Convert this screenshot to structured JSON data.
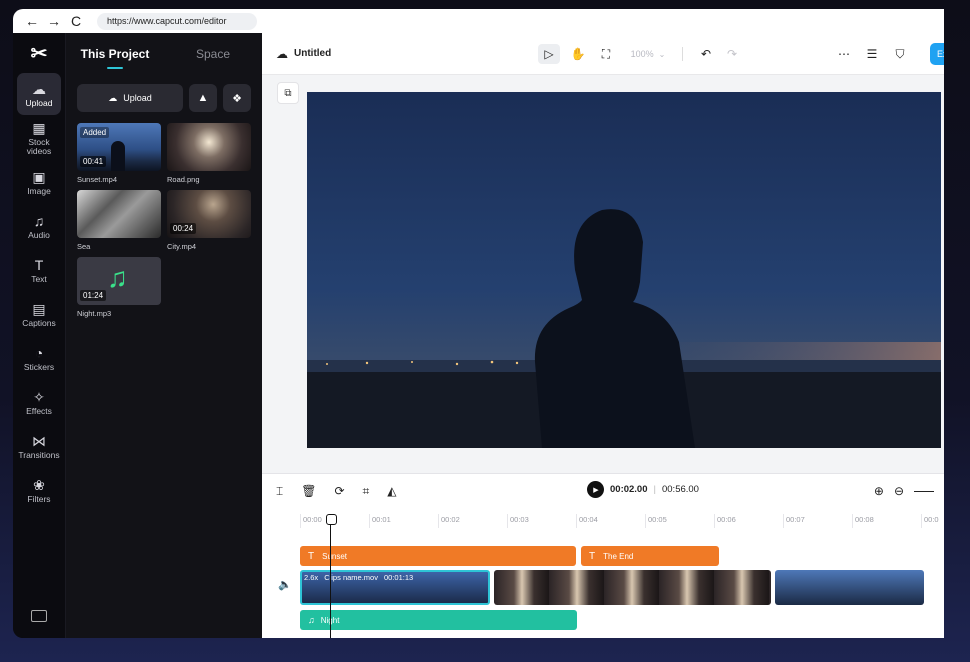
{
  "browser": {
    "back": "←",
    "forward": "→",
    "reload": "C",
    "url": "https://www.capcut.com/editor"
  },
  "rail": {
    "items": [
      {
        "label": "Upload",
        "icon": "cloud-upload-icon",
        "glyph": "☁"
      },
      {
        "label": "Stock videos",
        "icon": "film-icon",
        "glyph": "▦"
      },
      {
        "label": "Image",
        "icon": "image-icon",
        "glyph": "▣"
      },
      {
        "label": "Audio",
        "icon": "music-note-icon",
        "glyph": "♫"
      },
      {
        "label": "Text",
        "icon": "text-icon",
        "glyph": "T"
      },
      {
        "label": "Captions",
        "icon": "captions-icon",
        "glyph": "▤"
      },
      {
        "label": "Stickers",
        "icon": "sticker-icon",
        "glyph": "◔"
      },
      {
        "label": "Effects",
        "icon": "sparkle-icon",
        "glyph": "✧"
      },
      {
        "label": "Transitions",
        "icon": "bowtie-icon",
        "glyph": "⋈"
      },
      {
        "label": "Filters",
        "icon": "filters-icon",
        "glyph": "❀"
      }
    ]
  },
  "panel": {
    "tab_project": "This Project",
    "tab_space": "Space",
    "upload_label": "Upload",
    "media": [
      {
        "name": "Sunset.mp4",
        "duration": "00:41",
        "badge": "Added"
      },
      {
        "name": "Road.png",
        "duration": "",
        "badge": ""
      },
      {
        "name": "Sea",
        "duration": "",
        "badge": ""
      },
      {
        "name": "City.mp4",
        "duration": "00:24",
        "badge": ""
      },
      {
        "name": "Night.mp3",
        "duration": "01:24",
        "badge": ""
      }
    ]
  },
  "topbar": {
    "title": "Untitled",
    "zoom": "100%",
    "export_label": "Ex"
  },
  "timeline": {
    "current_time": "00:02.00",
    "total_time": "00:56.00",
    "ruler": [
      "00:00",
      "00:01",
      "00:02",
      "00:03",
      "00:04",
      "00:05",
      "00:06",
      "00:07",
      "00:08",
      "00:0"
    ],
    "text_clips": [
      "Sunset",
      "The End"
    ],
    "video_clip_speed": "2.6x",
    "video_clip_name": "Clips name.mov",
    "video_clip_time": "00:01:13",
    "audio_clip": "Night"
  },
  "colors": {
    "accent": "#2ec4d6",
    "export": "#1fa2f2",
    "text_clip": "#f07a26",
    "audio_clip": "#22c0a0"
  }
}
